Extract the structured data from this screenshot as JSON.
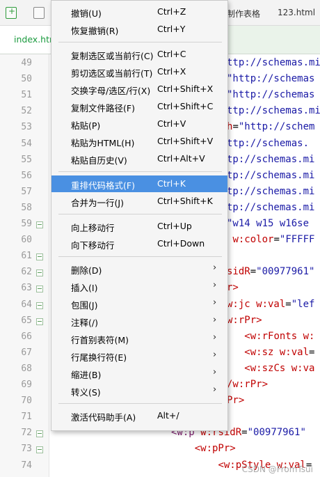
{
  "toolbar": {
    "tab_prev": "制作表格",
    "tab_file": "123.html"
  },
  "tabs": {
    "active": "index.htm"
  },
  "editor": {
    "line_numbers": [
      "49",
      "50",
      "51",
      "52",
      "53",
      "54",
      "55",
      "56",
      "57",
      "58",
      "59",
      "60",
      "61",
      "62",
      "63",
      "64",
      "65",
      "66",
      "67",
      "68",
      "69",
      "70",
      "71",
      "72",
      "73",
      "74"
    ],
    "code": [
      {
        "pre": "",
        "a": "",
        "eq": "",
        "v": "ttp://schemas.mi"
      },
      {
        "pre": "",
        "a": "",
        "eq": "",
        "v": "\"http://schemas"
      },
      {
        "pre": "",
        "a": "",
        "eq": "",
        "v": "\"http://schemas"
      },
      {
        "pre": "",
        "a": "",
        "eq": "",
        "v": "ttp://schemas.mi"
      },
      {
        "pre": "",
        "a": "h",
        "eq": "=",
        "v": "\"http://schem"
      },
      {
        "pre": "",
        "a": "",
        "eq": "",
        "v": "ttp://schemas."
      },
      {
        "pre": "",
        "a": "",
        "eq": "",
        "v": "tp://schemas.mi"
      },
      {
        "pre": "",
        "a": "",
        "eq": "",
        "v": "tp://schemas.mi"
      },
      {
        "pre": "",
        "a": "",
        "eq": "",
        "v": "tp://schemas.mi"
      },
      {
        "pre": "",
        "a": "",
        "eq": "",
        "v": "tp://schemas.mi"
      },
      {
        "pre": "",
        "a": "",
        "eq": "",
        "v": "\"w14 w15 w16se"
      },
      {
        "pre": " ",
        "a": "w:color",
        "eq": "=",
        "v": "\"FFFFF"
      },
      {
        "pre": "",
        "a": "",
        "eq": "",
        "v": ""
      },
      {
        "pre": "",
        "a": "sidR",
        "eq": "=",
        "v": "\"00977961\""
      },
      {
        "pre": "",
        "a": "r>",
        "eq": "",
        "v": ""
      },
      {
        "pre": "",
        "a": "w:jc w:val",
        "eq": "=",
        "v": "\"lef"
      },
      {
        "pre": "",
        "a": "w:rPr>",
        "eq": "",
        "v": ""
      },
      {
        "pre": "   ",
        "a": "<w:rFonts w:",
        "eq": "",
        "v": ""
      },
      {
        "pre": "   ",
        "a": "<w:sz w:val",
        "eq": "=",
        "v": ""
      },
      {
        "pre": "   ",
        "a": "<w:szCs w:va",
        "eq": "",
        "v": ""
      },
      {
        "pre": "",
        "a": "/w:rPr>",
        "eq": "",
        "v": ""
      },
      {
        "pre": "",
        "a": "Pr>",
        "eq": "",
        "v": ""
      },
      {
        "pre": "",
        "a": "",
        "eq": "",
        "v": ""
      },
      {
        "pre": "<w:p ",
        "a": "w:rsidR",
        "eq": "=",
        "v": "\"00977961\""
      },
      {
        "pre": "    ",
        "a": "<w:pPr>",
        "eq": "",
        "v": ""
      },
      {
        "pre": "        ",
        "a": "<w:pStyle w:val",
        "eq": "=",
        "v": ""
      }
    ],
    "watermark": "CSDN @FromTsui"
  },
  "menu": {
    "items": [
      {
        "label": "撤销(U)",
        "shortcut": "Ctrl+Z"
      },
      {
        "label": "恢复撤销(R)",
        "shortcut": "Ctrl+Y"
      },
      {
        "label": "复制选区或当前行(C)",
        "shortcut": "Ctrl+C"
      },
      {
        "label": "剪切选区或当前行(T)",
        "shortcut": "Ctrl+X"
      },
      {
        "label": "交换字母/选区/行(X)",
        "shortcut": "Ctrl+Shift+X"
      },
      {
        "label": "复制文件路径(F)",
        "shortcut": "Ctrl+Shift+C"
      },
      {
        "label": "粘贴(P)",
        "shortcut": "Ctrl+V"
      },
      {
        "label": "粘贴为HTML(H)",
        "shortcut": "Ctrl+Shift+V"
      },
      {
        "label": "粘贴自历史(V)",
        "shortcut": "Ctrl+Alt+V"
      },
      {
        "label": "重排代码格式(F)",
        "shortcut": "Ctrl+K"
      },
      {
        "label": "合并为一行(J)",
        "shortcut": "Ctrl+Shift+K"
      },
      {
        "label": "向上移动行",
        "shortcut": "Ctrl+Up"
      },
      {
        "label": "向下移动行",
        "shortcut": "Ctrl+Down"
      },
      {
        "label": "删除(D)",
        "shortcut": ""
      },
      {
        "label": "插入(I)",
        "shortcut": ""
      },
      {
        "label": "包围(J)",
        "shortcut": ""
      },
      {
        "label": "注释(/)",
        "shortcut": ""
      },
      {
        "label": "行首别表符(M)",
        "shortcut": ""
      },
      {
        "label": "行尾换行符(E)",
        "shortcut": ""
      },
      {
        "label": "缩进(B)",
        "shortcut": ""
      },
      {
        "label": "转义(S)",
        "shortcut": ""
      },
      {
        "label": "激活代码助手(A)",
        "shortcut": "Alt+/"
      }
    ],
    "highlighted_index": 9,
    "highlight_color": "#4a90e2"
  }
}
